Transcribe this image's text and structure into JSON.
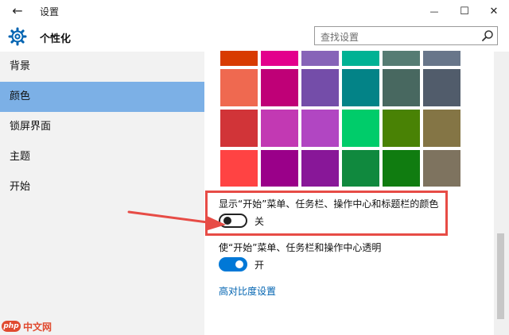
{
  "window": {
    "back_glyph": "←",
    "title": "设置",
    "minimize_glyph": "—",
    "maximize_glyph": "☐",
    "close_glyph": "✕"
  },
  "header": {
    "app_name": "个性化",
    "search_placeholder": "查找设置"
  },
  "sidebar": {
    "items": [
      {
        "label": "背景",
        "selected": false
      },
      {
        "label": "颜色",
        "selected": true
      },
      {
        "label": "锁屏界面",
        "selected": false
      },
      {
        "label": "主题",
        "selected": false
      },
      {
        "label": "开始",
        "selected": false
      }
    ]
  },
  "palette": {
    "rows": [
      [
        "#d83b01",
        "#e3008c",
        "#8764b8",
        "#00b294",
        "#567c73",
        "#68768a"
      ],
      [
        "#ef6950",
        "#bf0077",
        "#744da9",
        "#038387",
        "#486860",
        "#515c6b"
      ],
      [
        "#d13438",
        "#c239b3",
        "#b146c2",
        "#00cc6a",
        "#498205",
        "#847545"
      ],
      [
        "#ff4343",
        "#9a0089",
        "#881798",
        "#10893e",
        "#107c10",
        "#7e735f"
      ]
    ]
  },
  "options": {
    "show_color": {
      "label": "显示“开始”菜单、任务栏、操作中心和标题栏的颜色",
      "state": "关",
      "on": false
    },
    "transparency": {
      "label": "使“开始”菜单、任务栏和操作中心透明",
      "state": "开",
      "on": true
    },
    "high_contrast_link": "高对比度设置"
  },
  "annotation": {
    "highlight_color": "#e74c46"
  },
  "watermark": {
    "logo_text": "php",
    "text": "中文网"
  }
}
